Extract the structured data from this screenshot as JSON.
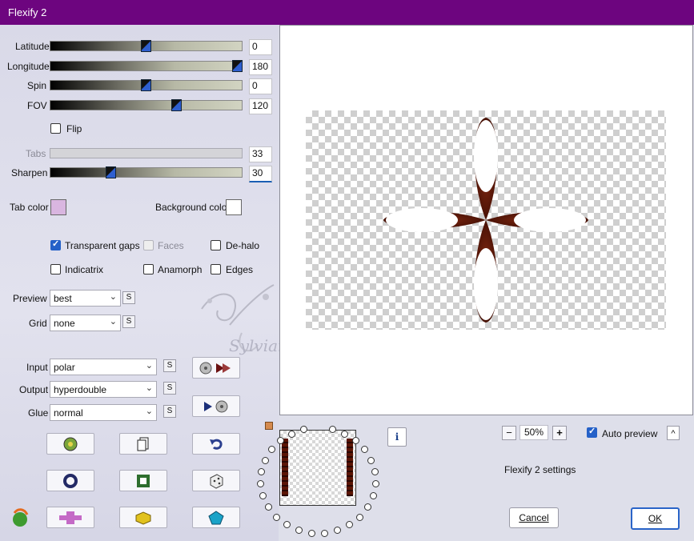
{
  "window": {
    "title": "Flexify 2"
  },
  "sliders": [
    {
      "label": "Latitude",
      "value": "0",
      "position": 0.5
    },
    {
      "label": "Longitude",
      "value": "180",
      "position": 0.98
    },
    {
      "label": "Spin",
      "value": "0",
      "position": 0.5
    },
    {
      "label": "FOV",
      "value": "120",
      "position": 0.66
    },
    {
      "label": "Tabs",
      "value": "33",
      "position": 0.0,
      "disabled": true
    },
    {
      "label": "Sharpen",
      "value": "30",
      "position": 0.3
    }
  ],
  "flip": {
    "label": "Flip",
    "checked": false
  },
  "tab_color": {
    "label": "Tab color",
    "color": "#d9b6e0"
  },
  "background_color": {
    "label": "Background color",
    "color": "#ffffff"
  },
  "options": {
    "transparent_gaps": {
      "label": "Transparent gaps",
      "checked": true
    },
    "faces": {
      "label": "Faces",
      "checked": false,
      "disabled": true
    },
    "de_halo": {
      "label": "De-halo",
      "checked": false
    },
    "indicatrix": {
      "label": "Indicatrix",
      "checked": false
    },
    "anamorph": {
      "label": "Anamorph",
      "checked": false
    },
    "edges": {
      "label": "Edges",
      "checked": false
    }
  },
  "preview_select": {
    "label": "Preview",
    "value": "best"
  },
  "grid_select": {
    "label": "Grid",
    "value": "none"
  },
  "input_select": {
    "label": "Input",
    "value": "polar"
  },
  "output_select": {
    "label": "Output",
    "value": "hyperdouble"
  },
  "glue_select": {
    "label": "Glue",
    "value": "normal"
  },
  "small_button_label": "S",
  "watermark": "Sylviane",
  "zoom": {
    "value": "50%",
    "minus": "−",
    "plus": "+"
  },
  "auto_preview": {
    "label": "Auto preview",
    "checked": true
  },
  "collapse_label": "^",
  "settings_label": "Flexify 2 settings",
  "info_label": "i",
  "cancel_label": "Cancel",
  "ok_label": "OK",
  "colors": {
    "accent": "#6d057f",
    "petal": "#5b1505",
    "check_blue": "#2561c8"
  }
}
